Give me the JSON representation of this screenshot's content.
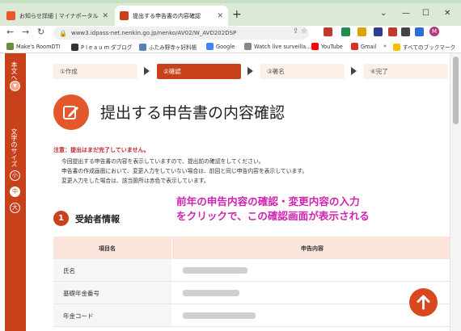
{
  "browser": {
    "tabs": [
      {
        "label": "お知らせ詳細 | マイナポータル",
        "active": false,
        "favicon_color": "#e9572a"
      },
      {
        "label": "提出する申告書の内容確認",
        "active": true,
        "favicon_color": "#c7421a"
      }
    ],
    "new_tab_icon": "+",
    "window_controls": {
      "chevron": "⌄",
      "minimize": "—",
      "maximize": "☐",
      "close": "✕"
    },
    "nav": {
      "back": "←",
      "forward": "→",
      "reload": "↻"
    },
    "url": "www3.idpass-net.nenkin.go.jp/nenko/AV02/W_AVD202DSP",
    "bookmarks": [
      {
        "label": "Make's RoomDTI",
        "icon_color": "#6b8e3d"
      },
      {
        "label": "P l e a u m ダブログ",
        "icon_color": "#333333"
      },
      {
        "label": "ふたみ野寺ヶ好料帳",
        "icon_color": "#5b7fb8"
      },
      {
        "label": "Google",
        "icon_color": "#4285f4"
      },
      {
        "label": "Watch live surveilla...",
        "icon_color": "#888888"
      },
      {
        "label": "YouTube",
        "icon_color": "#ff0000"
      },
      {
        "label": "Gmail",
        "icon_color": "#d93025"
      },
      {
        "label": "»",
        "icon_color": ""
      },
      {
        "label": "すべてのブックマーク",
        "icon_color": "#f2c200"
      }
    ],
    "profile_initial": "M"
  },
  "sidebar": {
    "body_text_label": "本文へ",
    "font_size_label": "文字のサイズ",
    "sizes": [
      "小",
      "中",
      "大"
    ],
    "selected_size": "中",
    "accent": "#c7421a"
  },
  "steps": [
    {
      "label": "①作成",
      "current": false
    },
    {
      "label": "②確認",
      "current": true
    },
    {
      "label": "③署名",
      "current": false
    },
    {
      "label": "④完了",
      "current": false
    }
  ],
  "page": {
    "title": "提出する申告書の内容確認",
    "notice_title": "注意：提出はまだ完了していません。",
    "notice_lines": [
      "今回提出する申告書の内容を表示していますので、提出前の確認をしてください。",
      "申告書の作成画面において、変更入力をしていない場合は、前回と同じ申告内容を表示しています。",
      "変更入力をした場合は、該当箇所は赤色で表示しています。"
    ],
    "annotation_lines": [
      "前年の申告内容の確認・変更内容の入力",
      "をクリックで、この確認画面が表示される"
    ],
    "annotation_color": "#cf23b0",
    "section": {
      "number": "1",
      "title": "受給者情報"
    },
    "table": {
      "headers": [
        "項目名",
        "申告内容"
      ],
      "rows": [
        {
          "label": "氏名",
          "value": "(ぼかし)"
        },
        {
          "label": "基礎年金番号",
          "value": "(ぼかし)"
        },
        {
          "label": "年金コード",
          "value": "(ぼかし)"
        }
      ]
    },
    "back_to_top_icon": "arrow-up-icon"
  }
}
